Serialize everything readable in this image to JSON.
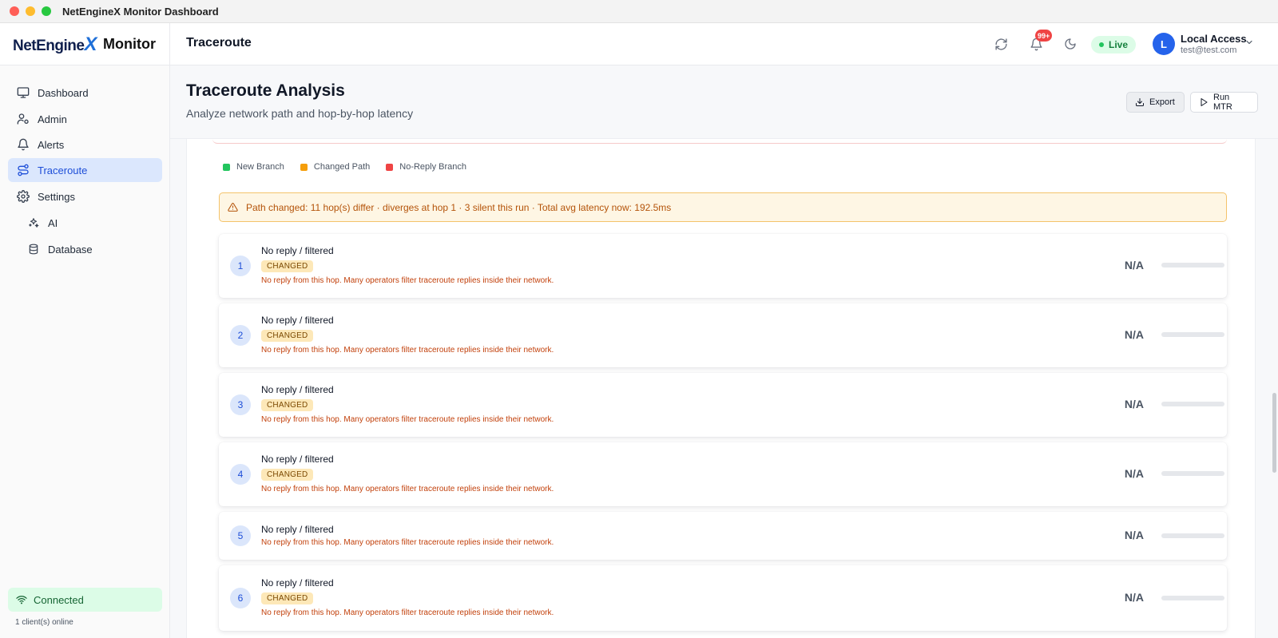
{
  "window": {
    "title": "NetEngineX Monitor Dashboard"
  },
  "brand": {
    "logo_pre": "NetEngine",
    "logo_x": "X",
    "name": "Monitor"
  },
  "header": {
    "page": "Traceroute",
    "notification_count": "99+",
    "live_label": "Live",
    "user": {
      "initial": "L",
      "name": "Local Access",
      "email": "test@test.com"
    }
  },
  "sidebar": {
    "items": [
      {
        "label": "Dashboard",
        "icon": "monitor-icon"
      },
      {
        "label": "Admin",
        "icon": "user-cog-icon"
      },
      {
        "label": "Alerts",
        "icon": "bell-icon"
      },
      {
        "label": "Traceroute",
        "icon": "route-icon",
        "active": true
      },
      {
        "label": "Settings",
        "icon": "gear-icon"
      }
    ],
    "sub_items": [
      {
        "label": "AI",
        "icon": "sparkles-icon"
      },
      {
        "label": "Database",
        "icon": "database-icon"
      }
    ],
    "connection": {
      "label": "Connected",
      "clients": "1 client(s) online"
    }
  },
  "main": {
    "title": "Traceroute Analysis",
    "subtitle": "Analyze network path and hop-by-hop latency",
    "export_label": "Export",
    "run_label": "Run MTR",
    "legend": [
      {
        "label": "New Branch",
        "color": "#22c55e"
      },
      {
        "label": "Changed Path",
        "color": "#f59e0b"
      },
      {
        "label": "No-Reply Branch",
        "color": "#ef4444"
      }
    ],
    "alert": "Path changed: 11 hop(s) differ · diverges at hop 1 · 3 silent this run · Total avg latency now: 192.5ms",
    "hops": [
      {
        "num": "1",
        "title": "No reply / filtered",
        "badge": "CHANGED",
        "desc": "No reply from this hop. Many operators filter traceroute replies inside their network.",
        "latency": "N/A"
      },
      {
        "num": "2",
        "title": "No reply / filtered",
        "badge": "CHANGED",
        "desc": "No reply from this hop. Many operators filter traceroute replies inside their network.",
        "latency": "N/A"
      },
      {
        "num": "3",
        "title": "No reply / filtered",
        "badge": "CHANGED",
        "desc": "No reply from this hop. Many operators filter traceroute replies inside their network.",
        "latency": "N/A"
      },
      {
        "num": "4",
        "title": "No reply / filtered",
        "badge": "CHANGED",
        "desc": "No reply from this hop. Many operators filter traceroute replies inside their network.",
        "latency": "N/A"
      },
      {
        "num": "5",
        "title": "No reply / filtered",
        "badge": "",
        "desc": "No reply from this hop. Many operators filter traceroute replies inside their network.",
        "latency": "N/A"
      },
      {
        "num": "6",
        "title": "No reply / filtered",
        "badge": "CHANGED",
        "desc": "No reply from this hop. Many operators filter traceroute replies inside their network.",
        "latency": "N/A"
      }
    ]
  }
}
